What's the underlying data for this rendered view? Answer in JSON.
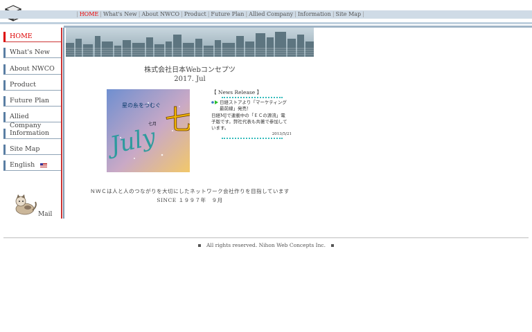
{
  "topnav": {
    "items": [
      "HOME",
      "What's New",
      "About NWCO",
      "Product",
      "Future Plan",
      "Allied Company",
      "Information",
      "Site Map"
    ]
  },
  "sidebar": {
    "items": [
      "HOME",
      "What's New",
      "About NWCO",
      "Product",
      "Future Plan",
      "Allied Company",
      "Information",
      "Site Map",
      "English"
    ],
    "mail": "Mail"
  },
  "main": {
    "company_name": "株式会社日本Webコンセプツ",
    "issue": "2017. Jul",
    "poster": {
      "title_kanji": "七夕",
      "month_kanji": "七月",
      "month_en": "July",
      "phrase": "星の糸をつむぐ"
    },
    "news": {
      "title": "【 News Release 】",
      "line1": "日経ストアより「マーケティング最前線」発売！",
      "line2": "日経MJで連載中の「ＥＣの源流」電子版です。弊社代表も共著で参加しています。",
      "date": "2013/5/21"
    },
    "mission": "ＮＷＣは人と人のつながりを大切にしたネットワーク会社作りを目指しています",
    "since": "SINCE １９９７年　９月"
  },
  "footer": {
    "text": "All rights reserved. Nihon Web Concepts Inc."
  },
  "colors": {
    "active": "#dd0000",
    "nav_bar": "#cfdbe6",
    "sidebar_accent": "#5a7ea3"
  }
}
